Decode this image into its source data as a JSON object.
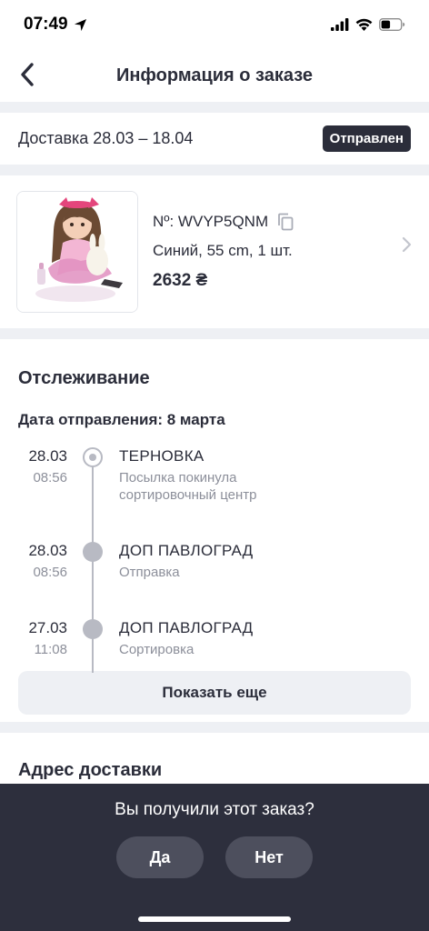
{
  "status_bar": {
    "time": "07:49"
  },
  "nav": {
    "title": "Информация о заказе"
  },
  "delivery": {
    "text": "Доставка 28.03 – 18.04",
    "status": "Отправлен"
  },
  "product": {
    "order_number": "Nº: WVYP5QNM",
    "variant": "Синий, 55 cm, 1 шт.",
    "price": "2632 ₴"
  },
  "tracking": {
    "title": "Отслеживание",
    "ship_date": "Дата отправления: 8 марта",
    "events": [
      {
        "date": "28.03",
        "time": "08:56",
        "place": "ТЕРНОВКА",
        "desc": "Посылка покинула сортировочный центр"
      },
      {
        "date": "28.03",
        "time": "08:56",
        "place": "ДОП ПАВЛОГРАД",
        "desc": "Отправка"
      },
      {
        "date": "27.03",
        "time": "11:08",
        "place": "ДОП ПАВЛОГРАД",
        "desc": "Сортировка"
      }
    ],
    "show_more": "Показать еще"
  },
  "address": {
    "title": "Адрес доставки"
  },
  "confirm": {
    "question": "Вы получили этот заказ?",
    "yes": "Да",
    "no": "Нет"
  },
  "colors": {
    "primary_dark": "#2b2d3a",
    "muted": "#8c8f9a",
    "divider": "#eef0f4",
    "panel": "#2d2f3d"
  }
}
